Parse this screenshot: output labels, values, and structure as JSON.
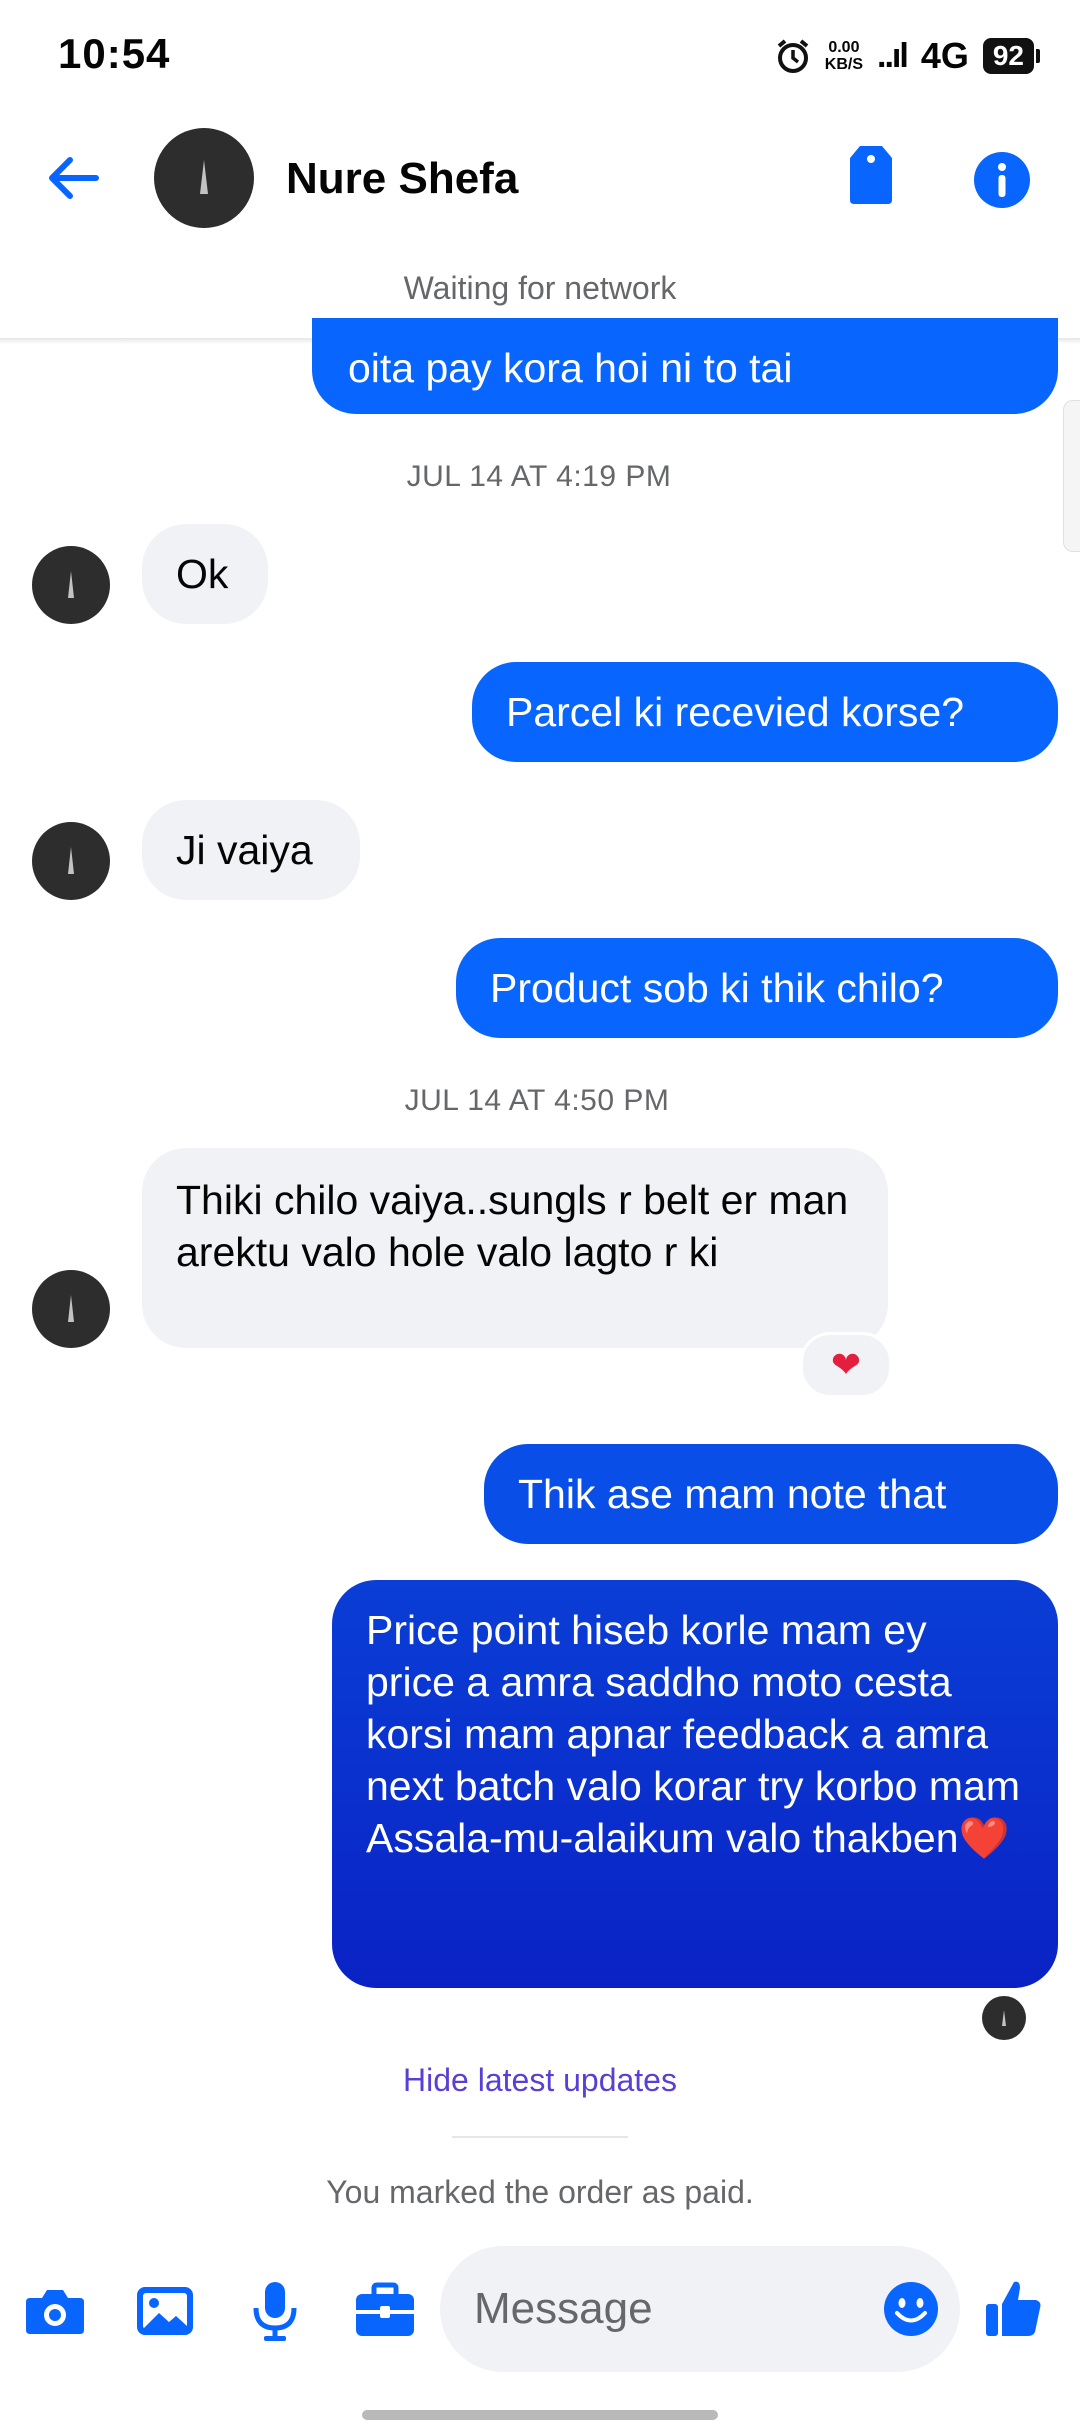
{
  "status_bar": {
    "time": "10:54",
    "net_speed_value": "0.00",
    "net_speed_unit": "KB/S",
    "signal": "..ıl",
    "network_type": "4G",
    "battery": "92"
  },
  "header": {
    "contact_name": "Nure Shefa",
    "network_status": "Waiting for network"
  },
  "conversation": {
    "messages": [
      {
        "dir": "out",
        "text": "oita pay kora hoi ni to tai"
      },
      {
        "dir": "stamp",
        "text": "JUL 14 AT 4:19 PM"
      },
      {
        "dir": "in",
        "text": "Ok"
      },
      {
        "dir": "out",
        "text": "Parcel ki recevied korse?"
      },
      {
        "dir": "in",
        "text": "Ji vaiya"
      },
      {
        "dir": "out",
        "text": "Product sob ki thik chilo?"
      },
      {
        "dir": "stamp",
        "text": "JUL 14 AT 4:50 PM"
      },
      {
        "dir": "in",
        "text": "Thiki chilo vaiya..sungls r belt er man arektu valo hole valo lagto r ki",
        "reaction": "❤"
      },
      {
        "dir": "out",
        "text": "Thik ase mam note that"
      },
      {
        "dir": "out",
        "text": "Price point hiseb korle mam ey price a amra saddho moto cesta korsi mam apnar feedback a amra next batch valo korar try korbo mam Assala-mu-alaikum valo thakben❤️"
      }
    ],
    "hide_updates_link": "Hide latest updates",
    "system_note": "You marked the order as paid."
  },
  "composer": {
    "placeholder": "Message",
    "icons": [
      "camera-icon",
      "gallery-icon",
      "microphone-icon",
      "briefcase-icon",
      "emoji-icon",
      "thumbs-up-icon"
    ]
  },
  "colors": {
    "outgoing_bubble": "#0866ff",
    "incoming_bubble": "#f0f2f5",
    "accent": "#0866ff",
    "link": "#5b3fd3"
  }
}
